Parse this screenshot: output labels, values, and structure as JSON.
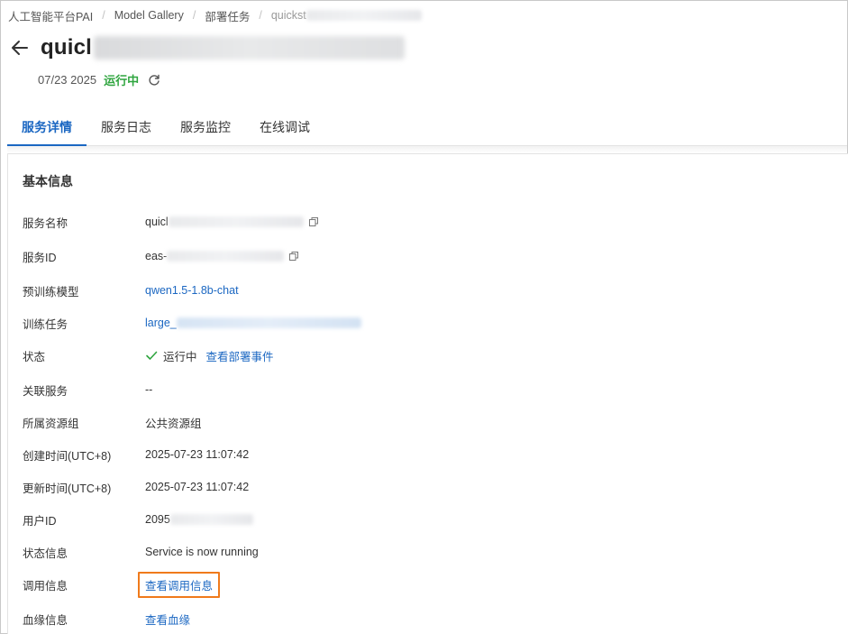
{
  "breadcrumb": {
    "items": [
      "人工智能平台PAI",
      "Model Gallery",
      "部署任务"
    ],
    "current_prefix": "quickst"
  },
  "header": {
    "title_prefix": "quicl",
    "date": "07/23 2025",
    "status": "运行中"
  },
  "tabs": [
    {
      "label": "服务详情",
      "active": true
    },
    {
      "label": "服务日志",
      "active": false
    },
    {
      "label": "服务监控",
      "active": false
    },
    {
      "label": "在线调试",
      "active": false
    }
  ],
  "basic_info": {
    "title": "基本信息",
    "service_name": {
      "label": "服务名称",
      "value_prefix": "quicl"
    },
    "service_id": {
      "label": "服务ID",
      "value_prefix": "eas-"
    },
    "pretrained_model": {
      "label": "预训练模型",
      "value": "qwen1.5-1.8b-chat"
    },
    "training_task": {
      "label": "训练任务",
      "value_prefix": "large_"
    },
    "status": {
      "label": "状态",
      "value": "运行中",
      "link": "查看部署事件"
    },
    "linked_service": {
      "label": "关联服务",
      "value": "--"
    },
    "resource_group": {
      "label": "所属资源组",
      "value": "公共资源组"
    },
    "created_time": {
      "label": "创建时间(UTC+8)",
      "value": "2025-07-23 11:07:42"
    },
    "updated_time": {
      "label": "更新时间(UTC+8)",
      "value": "2025-07-23 11:07:42"
    },
    "user_id": {
      "label": "用户ID",
      "value_prefix": "2095"
    },
    "status_info": {
      "label": "状态信息",
      "value": "Service is now running"
    },
    "invoke_info": {
      "label": "调用信息",
      "link": "查看调用信息"
    },
    "lineage_info": {
      "label": "血缘信息",
      "link": "查看血缘"
    }
  },
  "colors": {
    "accent_blue": "#1b67c2",
    "status_green": "#2fa53f",
    "highlight_orange": "#f07a1b"
  },
  "icons": [
    "arrow-left-icon",
    "refresh-icon",
    "copy-icon",
    "check-icon"
  ]
}
